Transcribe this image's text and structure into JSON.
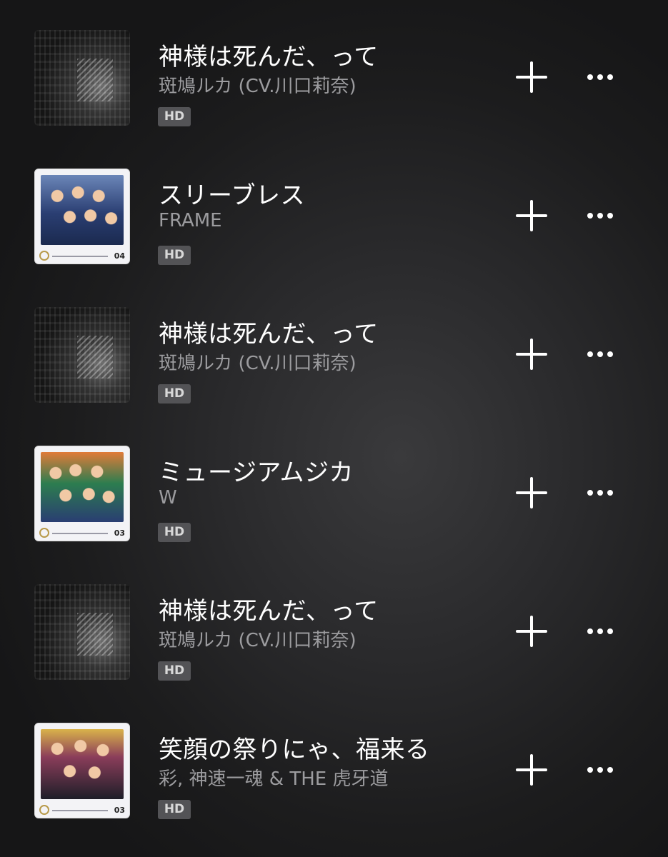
{
  "tracks": [
    {
      "title": "神様は死んだ、って",
      "artist": "斑鳩ルカ (CV.川口莉奈)",
      "quality_badge": "HD",
      "art_style": "dark"
    },
    {
      "title": "スリーブレス",
      "artist": "FRAME",
      "quality_badge": "HD",
      "art_style": "light",
      "art_disc_number": "04"
    },
    {
      "title": "神様は死んだ、って",
      "artist": "斑鳩ルカ (CV.川口莉奈)",
      "quality_badge": "HD",
      "art_style": "dark"
    },
    {
      "title": "ミュージアムジカ",
      "artist": "W",
      "quality_badge": "HD",
      "art_style": "light",
      "art_disc_number": "03"
    },
    {
      "title": "神様は死んだ、って",
      "artist": "斑鳩ルカ (CV.川口莉奈)",
      "quality_badge": "HD",
      "art_style": "dark"
    },
    {
      "title": "笑顔の祭りにゃ、福来る",
      "artist": "彩, 神速一魂 & THE 虎牙道",
      "quality_badge": "HD",
      "art_style": "light",
      "art_disc_number": "03"
    }
  ],
  "icons": {
    "add": "plus-icon",
    "more": "more-horizontal-icon"
  },
  "colors": {
    "title_text": "#ffffff",
    "artist_text": "#9c9c9f",
    "badge_background": "#535356",
    "background": "#2a2a2c"
  }
}
